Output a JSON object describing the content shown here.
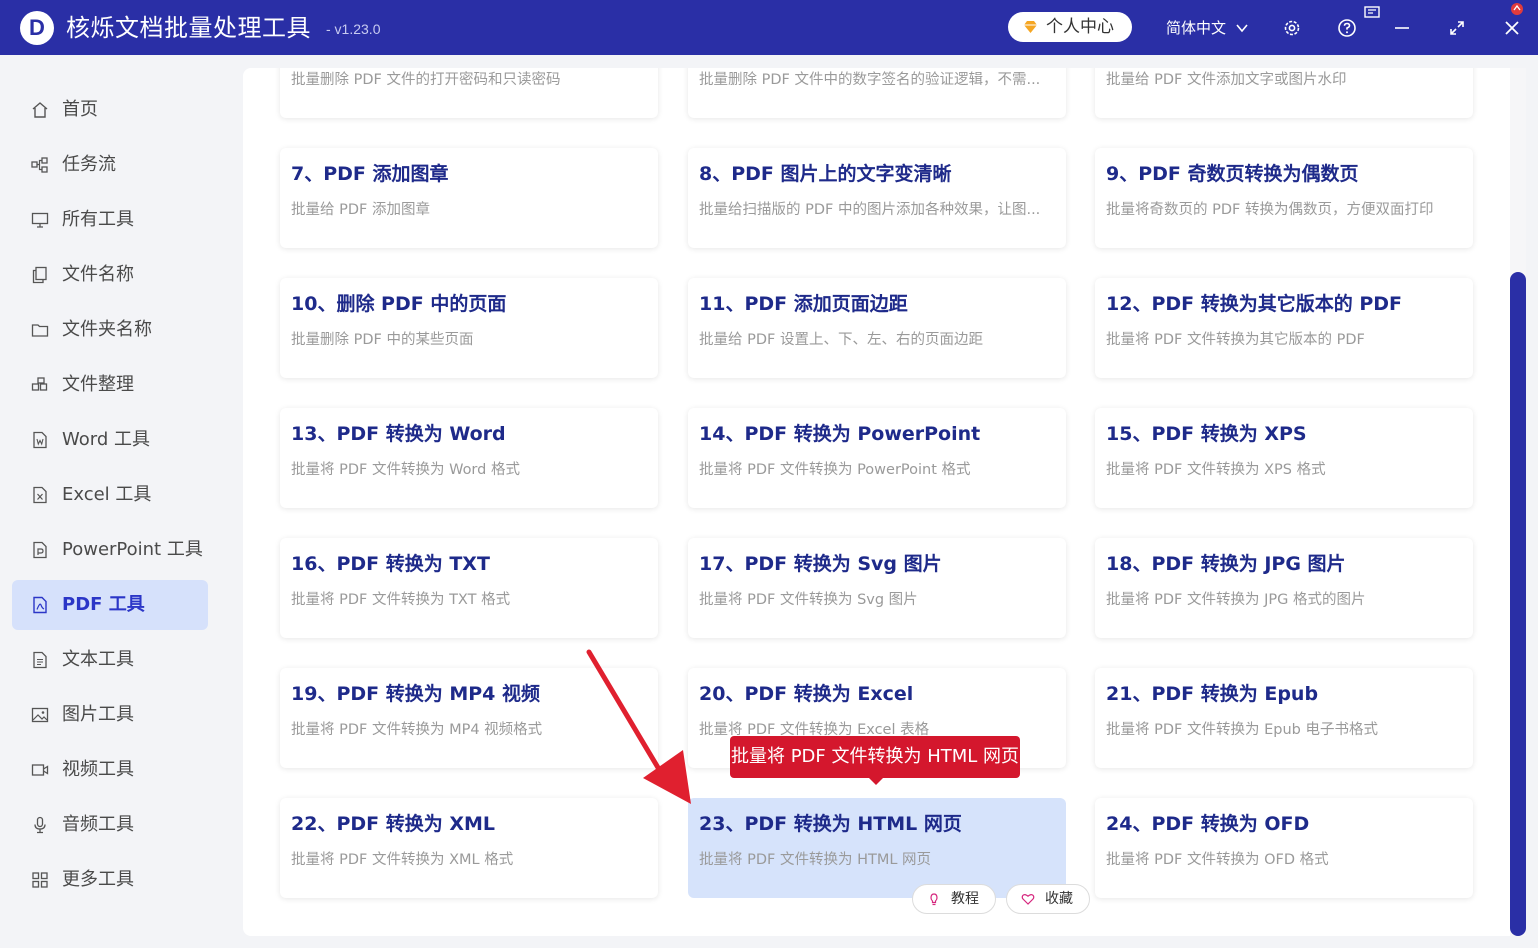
{
  "app": {
    "title": "核烁文档批量处理工具",
    "version": "- v1.23.0",
    "logo_letter": "D",
    "brand_color": "#2a2fa6",
    "accent_red": "#d4172d"
  },
  "titlebar": {
    "vip_label": "个人中心",
    "language": "简体中文"
  },
  "sidebar": {
    "items": [
      {
        "label": "首页",
        "icon": "home-icon"
      },
      {
        "label": "任务流",
        "icon": "workflow-icon"
      },
      {
        "label": "所有工具",
        "icon": "monitor-icon"
      },
      {
        "label": "文件名称",
        "icon": "file-copy-icon"
      },
      {
        "label": "文件夹名称",
        "icon": "folder-icon"
      },
      {
        "label": "文件整理",
        "icon": "organize-icon"
      },
      {
        "label": "Word 工具",
        "icon": "word-file-icon"
      },
      {
        "label": "Excel 工具",
        "icon": "excel-file-icon"
      },
      {
        "label": "PowerPoint 工具",
        "icon": "ppt-file-icon"
      },
      {
        "label": "PDF 工具",
        "icon": "pdf-file-icon",
        "active": true
      },
      {
        "label": "文本工具",
        "icon": "text-file-icon"
      },
      {
        "label": "图片工具",
        "icon": "image-icon"
      },
      {
        "label": "视频工具",
        "icon": "video-icon"
      },
      {
        "label": "音频工具",
        "icon": "microphone-icon"
      },
      {
        "label": "更多工具",
        "icon": "grid-icon"
      }
    ]
  },
  "cards": [
    {
      "title": "",
      "desc": "批量删除 PDF 文件的打开密码和只读密码"
    },
    {
      "title": "",
      "desc": "批量删除 PDF 文件中的数字签名的验证逻辑，不需..."
    },
    {
      "title": "",
      "desc": "批量给 PDF 文件添加文字或图片水印"
    },
    {
      "title": "7、PDF 添加图章",
      "desc": "批量给 PDF 添加图章"
    },
    {
      "title": "8、PDF 图片上的文字变清晰",
      "desc": "批量给扫描版的 PDF 中的图片添加各种效果，让图..."
    },
    {
      "title": "9、PDF 奇数页转换为偶数页",
      "desc": "批量将奇数页的 PDF 转换为偶数页，方便双面打印"
    },
    {
      "title": "10、删除 PDF 中的页面",
      "desc": "批量删除 PDF 中的某些页面"
    },
    {
      "title": "11、PDF 添加页面边距",
      "desc": "批量给 PDF 设置上、下、左、右的页面边距"
    },
    {
      "title": "12、PDF 转换为其它版本的 PDF",
      "desc": "批量将 PDF 文件转换为其它版本的 PDF"
    },
    {
      "title": "13、PDF 转换为 Word",
      "desc": "批量将 PDF 文件转换为 Word 格式"
    },
    {
      "title": "14、PDF 转换为 PowerPoint",
      "desc": "批量将 PDF 文件转换为 PowerPoint 格式"
    },
    {
      "title": "15、PDF 转换为 XPS",
      "desc": "批量将 PDF 文件转换为 XPS 格式"
    },
    {
      "title": "16、PDF 转换为 TXT",
      "desc": "批量将 PDF 文件转换为 TXT 格式"
    },
    {
      "title": "17、PDF 转换为 Svg 图片",
      "desc": "批量将 PDF 文件转换为 Svg 图片"
    },
    {
      "title": "18、PDF 转换为 JPG 图片",
      "desc": "批量将 PDF 文件转换为 JPG 格式的图片"
    },
    {
      "title": "19、PDF 转换为 MP4 视频",
      "desc": "批量将 PDF 文件转换为 MP4 视频格式"
    },
    {
      "title": "20、PDF 转换为 Excel",
      "desc": "批量将 PDF 文件转换为 Excel 表格"
    },
    {
      "title": "21、PDF 转换为 Epub",
      "desc": "批量将 PDF 文件转换为 Epub 电子书格式"
    },
    {
      "title": "22、PDF 转换为 XML",
      "desc": "批量将 PDF 文件转换为 XML 格式"
    },
    {
      "title": "23、PDF 转换为 HTML 网页",
      "desc": "批量将 PDF 文件转换为 HTML 网页",
      "selected": true
    },
    {
      "title": "24、PDF 转换为 OFD",
      "desc": "批量将 PDF 文件转换为 OFD 格式"
    }
  ],
  "card_actions": {
    "tutorial_label": "教程",
    "favorite_label": "收藏"
  },
  "tooltip": {
    "text": "批量将 PDF 文件转换为 HTML 网页"
  }
}
